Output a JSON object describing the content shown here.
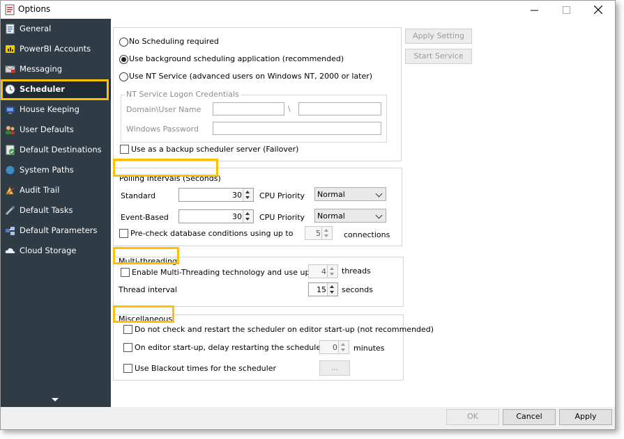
{
  "window": {
    "title": "Options"
  },
  "sidebar": {
    "items": [
      {
        "label": "General",
        "icon": "general-icon"
      },
      {
        "label": "PowerBI Accounts",
        "icon": "powerbi-icon"
      },
      {
        "label": "Messaging",
        "icon": "messaging-icon"
      },
      {
        "label": "Scheduler",
        "icon": "clock-icon",
        "active": true
      },
      {
        "label": "House Keeping",
        "icon": "housekeeping-icon"
      },
      {
        "label": "User Defaults",
        "icon": "users-icon"
      },
      {
        "label": "Default Destinations",
        "icon": "destinations-icon"
      },
      {
        "label": "System Paths",
        "icon": "globe-icon"
      },
      {
        "label": "Audit Trail",
        "icon": "audit-icon"
      },
      {
        "label": "Default Tasks",
        "icon": "tasks-icon"
      },
      {
        "label": "Default Parameters",
        "icon": "parameters-icon"
      },
      {
        "label": "Cloud Storage",
        "icon": "cloud-icon"
      }
    ]
  },
  "scheduling": {
    "option_none": "No Scheduling required",
    "option_background": "Use background scheduling application (recommended)",
    "option_nt": "Use NT Service (advanced users on Windows NT, 2000 or later)",
    "selected": "background",
    "nt_credentials": {
      "legend": "NT Service Logon Credentials",
      "domain_label": "Domain\\User Name",
      "separator": "\\",
      "password_label": "Windows Password",
      "domain_value": "",
      "user_value": "",
      "password_value": ""
    },
    "backup_label": "Use as a backup scheduler server (Failover)",
    "backup_checked": false
  },
  "buttons": {
    "apply_setting": "Apply Setting",
    "start_service": "Start Service"
  },
  "polling": {
    "header": "Polling Intervals (Seconds)",
    "standard_label": "Standard",
    "standard_value": "30",
    "standard_priority_label": "CPU Priority",
    "standard_priority": "Normal",
    "event_label": "Event-Based",
    "event_value": "30",
    "event_priority_label": "CPU Priority",
    "event_priority": "Normal",
    "precheck_label": "Pre-check database conditions using up to",
    "precheck_value": "5",
    "precheck_suffix": "connections",
    "precheck_checked": false
  },
  "multithreading": {
    "header": "Multi-threading",
    "enable_label": "Enable Multi-Threading technology and use up to",
    "enable_checked": false,
    "threads_value": "4",
    "threads_suffix": "threads",
    "interval_label": "Thread interval",
    "interval_value": "15",
    "interval_suffix": "seconds"
  },
  "misc": {
    "header": "Miscellaneous",
    "no_restart_label": "Do not check and restart the scheduler on editor start-up (not recommended)",
    "delay_label": "On editor start-up, delay restarting the scheduler for",
    "delay_value": "0",
    "delay_suffix": "minutes",
    "blackout_label": "Use Blackout times for the scheduler",
    "blackout_button": "..."
  },
  "footer": {
    "ok": "OK",
    "cancel": "Cancel",
    "apply": "Apply"
  },
  "colors": {
    "sidebar_bg": "#2f3b45",
    "highlight": "#ffc000"
  }
}
